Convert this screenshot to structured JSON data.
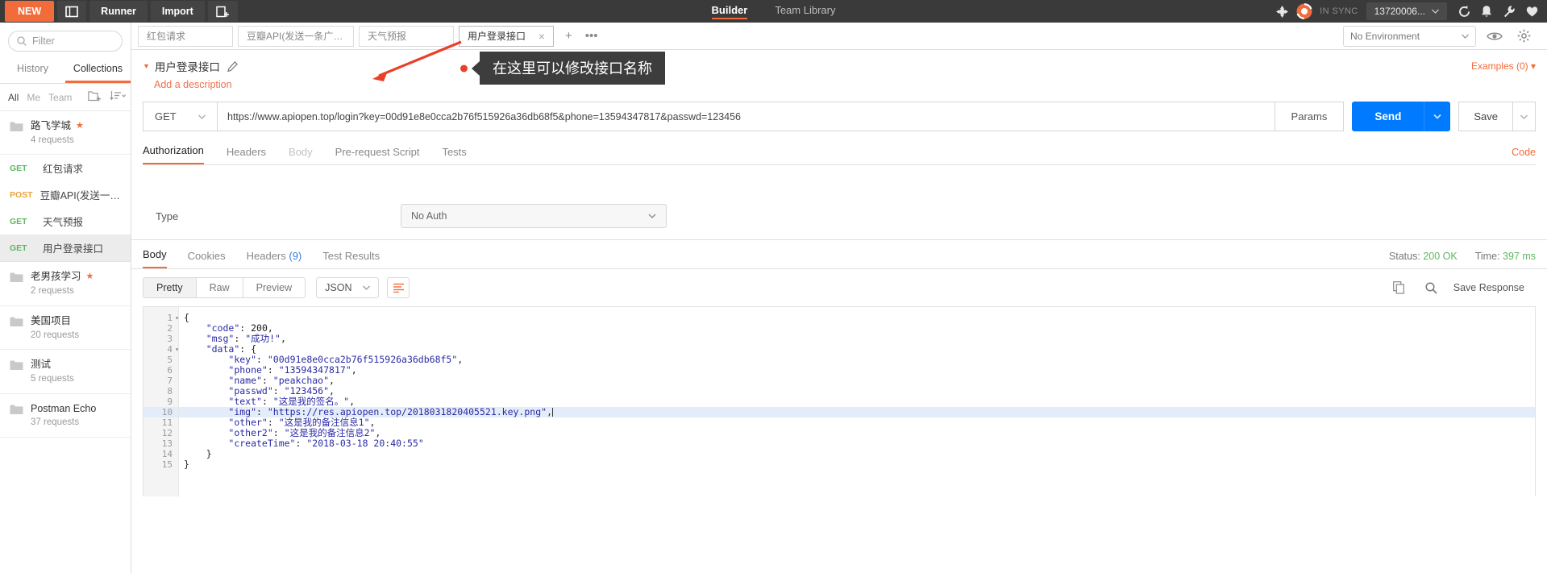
{
  "topbar": {
    "new_label": "NEW",
    "sidebar_toggle_icon": "panel-icon",
    "runner_label": "Runner",
    "import_label": "Import",
    "new_tab_icon": "new-window-icon",
    "tabs": [
      {
        "label": "Builder",
        "active": true
      },
      {
        "label": "Team Library",
        "active": false
      }
    ],
    "rocket_icon": "rocket-icon",
    "sync_icon": "sync-icon",
    "sync_label": "IN SYNC",
    "account_label": "13720006...",
    "account_caret": "chevron-down-icon",
    "icons": [
      "refresh-icon",
      "bell-icon",
      "wrench-icon",
      "heart-icon"
    ]
  },
  "sidebar": {
    "filter_placeholder": "Filter",
    "search_icon": "search-icon",
    "tabs": [
      {
        "label": "History",
        "active": false
      },
      {
        "label": "Collections",
        "active": true
      }
    ],
    "filters": [
      {
        "label": "All",
        "active": true
      },
      {
        "label": "Me",
        "active": false
      },
      {
        "label": "Team",
        "active": false
      }
    ],
    "new_folder_icon": "new-folder-icon",
    "sort_icon": "sort-icon",
    "items": [
      {
        "type": "collection",
        "name": "路飞学城",
        "sub": "4 requests",
        "starred": true
      },
      {
        "type": "request",
        "method": "GET",
        "name": "红包请求",
        "selected": false
      },
      {
        "type": "request",
        "method": "POST",
        "name": "豆瓣API(发送一条广...",
        "selected": false
      },
      {
        "type": "request",
        "method": "GET",
        "name": "天气预报",
        "selected": false
      },
      {
        "type": "request",
        "method": "GET",
        "name": "用户登录接口",
        "selected": true
      },
      {
        "type": "collection",
        "name": "老男孩学习",
        "sub": "2 requests",
        "starred": true
      },
      {
        "type": "collection",
        "name": "美国项目",
        "sub": "20 requests",
        "starred": false
      },
      {
        "type": "collection",
        "name": "测试",
        "sub": "5 requests",
        "starred": false
      },
      {
        "type": "collection",
        "name": "Postman Echo",
        "sub": "37 requests",
        "starred": false
      }
    ]
  },
  "tabstrip": {
    "tabs": [
      {
        "label": "红包请求",
        "active": false,
        "closable": false
      },
      {
        "label": "豆瓣API(发送一条广播)",
        "active": false,
        "closable": false
      },
      {
        "label": "天气预报",
        "active": false,
        "closable": false
      },
      {
        "label": "用户登录接口",
        "active": true,
        "closable": true
      }
    ],
    "add_label": "+",
    "more_label": "•••",
    "environment": "No Environment",
    "env_caret": "chevron-down-icon",
    "eye_icon": "eye-icon",
    "settings_icon": "gear-icon"
  },
  "request": {
    "title": "用户登录接口",
    "caret_icon": "caret-down-icon",
    "edit_icon": "pencil-icon",
    "description_link": "Add a description",
    "examples_label": "Examples (0)",
    "examples_caret": "chevron-down-icon",
    "method": "GET",
    "method_caret": "chevron-down-icon",
    "url": "https://www.apiopen.top/login?key=00d91e8e0cca2b76f515926a36db68f5&phone=13594347817&passwd=123456",
    "params_label": "Params",
    "send_label": "Send",
    "send_caret": "chevron-down-icon",
    "save_label": "Save",
    "save_caret": "chevron-down-icon",
    "tabs": [
      {
        "label": "Authorization",
        "active": true,
        "dim": false
      },
      {
        "label": "Headers",
        "active": false,
        "dim": false
      },
      {
        "label": "Body",
        "active": false,
        "dim": true
      },
      {
        "label": "Pre-request Script",
        "active": false,
        "dim": false
      },
      {
        "label": "Tests",
        "active": false,
        "dim": false
      }
    ],
    "code_link": "Code"
  },
  "annotation": {
    "tooltip_text": "在这里可以修改接口名称",
    "arrow_icon": "arrow-icon",
    "dot_color": "#e8412a",
    "tooltip_bg": "#3d3d3d"
  },
  "authorization": {
    "type_label": "Type",
    "type_value": "No Auth",
    "type_caret": "chevron-down-icon"
  },
  "response": {
    "tabs": [
      {
        "label": "Body",
        "active": true,
        "count": ""
      },
      {
        "label": "Cookies",
        "active": false,
        "count": ""
      },
      {
        "label": "Headers",
        "active": false,
        "count": "(9)"
      },
      {
        "label": "Test Results",
        "active": false,
        "count": ""
      }
    ],
    "status_label": "Status:",
    "status_value": "200 OK",
    "time_label": "Time:",
    "time_value": "397 ms",
    "formats": [
      {
        "label": "Pretty",
        "active": true
      },
      {
        "label": "Raw",
        "active": false
      },
      {
        "label": "Preview",
        "active": false
      }
    ],
    "lang": "JSON",
    "lang_caret": "chevron-down-icon",
    "wrap_icon": "wrap-lines-icon",
    "copy_icon": "copy-icon",
    "search_icon": "search-icon",
    "save_response_label": "Save Response",
    "body_lines": [
      {
        "n": 1,
        "fold": true,
        "indent": 0,
        "tokens": [
          {
            "t": "p",
            "v": "{"
          }
        ]
      },
      {
        "n": 2,
        "fold": false,
        "indent": 1,
        "tokens": [
          {
            "t": "k",
            "v": "\"code\""
          },
          {
            "t": "p",
            "v": ": "
          },
          {
            "t": "n",
            "v": "200"
          },
          {
            "t": "p",
            "v": ","
          }
        ]
      },
      {
        "n": 3,
        "fold": false,
        "indent": 1,
        "tokens": [
          {
            "t": "k",
            "v": "\"msg\""
          },
          {
            "t": "p",
            "v": ": "
          },
          {
            "t": "s",
            "v": "\"成功!\""
          },
          {
            "t": "p",
            "v": ","
          }
        ]
      },
      {
        "n": 4,
        "fold": true,
        "indent": 1,
        "tokens": [
          {
            "t": "k",
            "v": "\"data\""
          },
          {
            "t": "p",
            "v": ": {"
          }
        ]
      },
      {
        "n": 5,
        "fold": false,
        "indent": 2,
        "tokens": [
          {
            "t": "k",
            "v": "\"key\""
          },
          {
            "t": "p",
            "v": ": "
          },
          {
            "t": "s",
            "v": "\"00d91e8e0cca2b76f515926a36db68f5\""
          },
          {
            "t": "p",
            "v": ","
          }
        ]
      },
      {
        "n": 6,
        "fold": false,
        "indent": 2,
        "tokens": [
          {
            "t": "k",
            "v": "\"phone\""
          },
          {
            "t": "p",
            "v": ": "
          },
          {
            "t": "s",
            "v": "\"13594347817\""
          },
          {
            "t": "p",
            "v": ","
          }
        ]
      },
      {
        "n": 7,
        "fold": false,
        "indent": 2,
        "tokens": [
          {
            "t": "k",
            "v": "\"name\""
          },
          {
            "t": "p",
            "v": ": "
          },
          {
            "t": "s",
            "v": "\"peakchao\""
          },
          {
            "t": "p",
            "v": ","
          }
        ]
      },
      {
        "n": 8,
        "fold": false,
        "indent": 2,
        "tokens": [
          {
            "t": "k",
            "v": "\"passwd\""
          },
          {
            "t": "p",
            "v": ": "
          },
          {
            "t": "s",
            "v": "\"123456\""
          },
          {
            "t": "p",
            "v": ","
          }
        ]
      },
      {
        "n": 9,
        "fold": false,
        "indent": 2,
        "tokens": [
          {
            "t": "k",
            "v": "\"text\""
          },
          {
            "t": "p",
            "v": ": "
          },
          {
            "t": "s",
            "v": "\"这是我的签名。\""
          },
          {
            "t": "p",
            "v": ","
          }
        ]
      },
      {
        "n": 10,
        "fold": false,
        "indent": 2,
        "highlight": true,
        "cursor": true,
        "tokens": [
          {
            "t": "k",
            "v": "\"img\""
          },
          {
            "t": "p",
            "v": ": "
          },
          {
            "t": "s",
            "v": "\"https://res.apiopen.top/2018031820405521.key.png\""
          },
          {
            "t": "p",
            "v": ","
          }
        ]
      },
      {
        "n": 11,
        "fold": false,
        "indent": 2,
        "tokens": [
          {
            "t": "k",
            "v": "\"other\""
          },
          {
            "t": "p",
            "v": ": "
          },
          {
            "t": "s",
            "v": "\"这是我的备注信息1\""
          },
          {
            "t": "p",
            "v": ","
          }
        ]
      },
      {
        "n": 12,
        "fold": false,
        "indent": 2,
        "tokens": [
          {
            "t": "k",
            "v": "\"other2\""
          },
          {
            "t": "p",
            "v": ": "
          },
          {
            "t": "s",
            "v": "\"这是我的备注信息2\""
          },
          {
            "t": "p",
            "v": ","
          }
        ]
      },
      {
        "n": 13,
        "fold": false,
        "indent": 2,
        "tokens": [
          {
            "t": "k",
            "v": "\"createTime\""
          },
          {
            "t": "p",
            "v": ": "
          },
          {
            "t": "s",
            "v": "\"2018-03-18 20:40:55\""
          }
        ]
      },
      {
        "n": 14,
        "fold": false,
        "indent": 1,
        "tokens": [
          {
            "t": "p",
            "v": "}"
          }
        ]
      },
      {
        "n": 15,
        "fold": false,
        "indent": 0,
        "tokens": [
          {
            "t": "p",
            "v": "}"
          }
        ]
      }
    ]
  },
  "colors": {
    "accent": "#f26b3a",
    "send_blue": "#007bff",
    "get_green": "#5fb760",
    "post_orange": "#e9a33a",
    "topbar_bg": "#3a3a3a"
  }
}
